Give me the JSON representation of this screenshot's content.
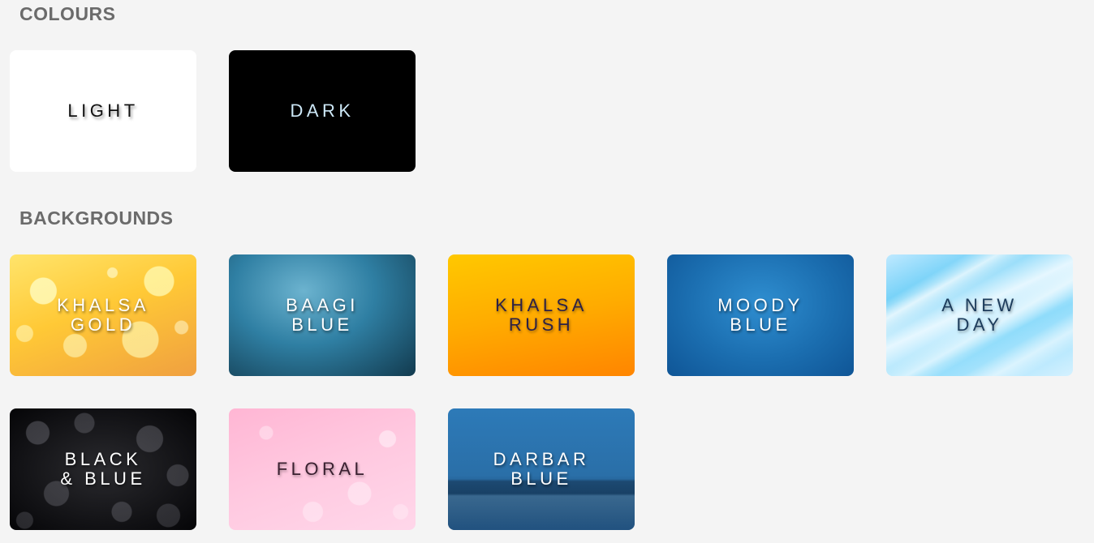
{
  "sections": {
    "colours": {
      "heading": "COLOURS",
      "tiles": [
        {
          "label": "LIGHT",
          "style": "light",
          "color": "#ffffff"
        },
        {
          "label": "DARK",
          "style": "dark",
          "color": "#000000"
        }
      ]
    },
    "backgrounds": {
      "heading": "BACKGROUNDS",
      "tiles": [
        {
          "label": "KHALSA\nGOLD",
          "style": "gold bokeh"
        },
        {
          "label": "BAAGI\nBLUE",
          "style": "teal blue texture"
        },
        {
          "label": "KHALSA\nRUSH",
          "style": "orange gradient"
        },
        {
          "label": "MOODY\nBLUE",
          "style": "deep blue texture"
        },
        {
          "label": "A NEW\nDAY",
          "style": "light sky blue streaks"
        },
        {
          "label": "BLACK\n& BLUE",
          "style": "dark bokeh"
        },
        {
          "label": "FLORAL",
          "style": "pink bokeh"
        },
        {
          "label": "DARBAR\nBLUE",
          "style": "blue night cityscape"
        }
      ]
    }
  }
}
